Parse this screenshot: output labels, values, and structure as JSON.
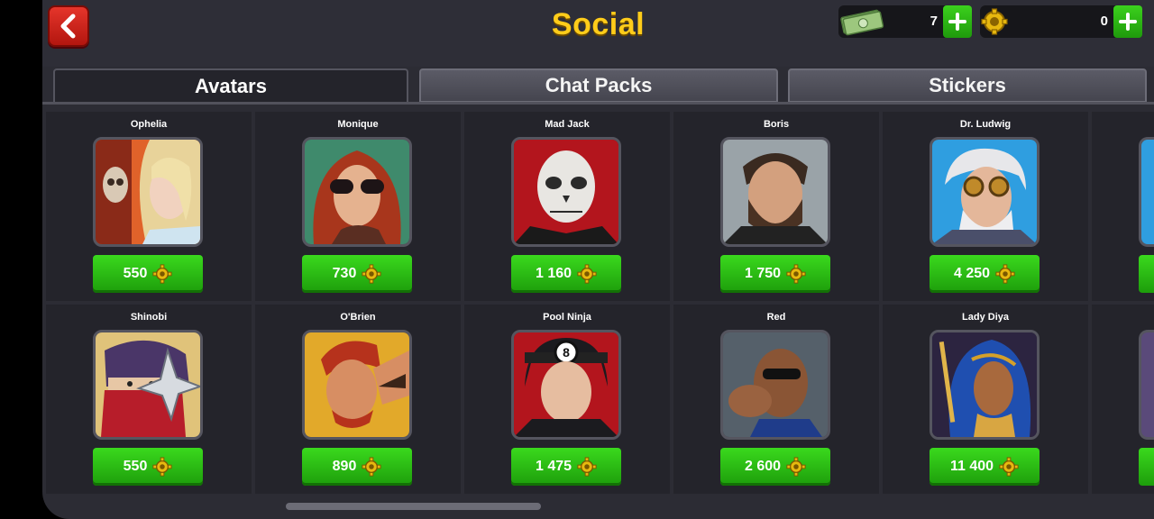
{
  "header": {
    "title": "Social",
    "cash_amount": "7",
    "coins_amount": "0"
  },
  "tabs": [
    {
      "label": "Avatars",
      "active": true
    },
    {
      "label": "Chat Packs",
      "active": false
    },
    {
      "label": "Stickers",
      "active": false
    }
  ],
  "avatars": [
    {
      "name": "Ophelia",
      "price": "550",
      "icon": "avatar-ophelia"
    },
    {
      "name": "Monique",
      "price": "730",
      "icon": "avatar-monique"
    },
    {
      "name": "Mad Jack",
      "price": "1 160",
      "icon": "avatar-mad-jack"
    },
    {
      "name": "Boris",
      "price": "1 750",
      "icon": "avatar-boris"
    },
    {
      "name": "Dr. Ludwig",
      "price": "4 250",
      "icon": "avatar-dr-ludwig"
    },
    {
      "name": "Shinobi",
      "price": "550",
      "icon": "avatar-shinobi"
    },
    {
      "name": "O'Brien",
      "price": "890",
      "icon": "avatar-obrien"
    },
    {
      "name": "Pool Ninja",
      "price": "1 475",
      "icon": "avatar-pool-ninja"
    },
    {
      "name": "Red",
      "price": "2 600",
      "icon": "avatar-red"
    },
    {
      "name": "Lady Diya",
      "price": "11 400",
      "icon": "avatar-lady-diya"
    }
  ],
  "colors": {
    "title": "#ffcc1a",
    "price_button": "#2cbf15",
    "back_button": "#d42a20",
    "background": "#2c2c34"
  }
}
